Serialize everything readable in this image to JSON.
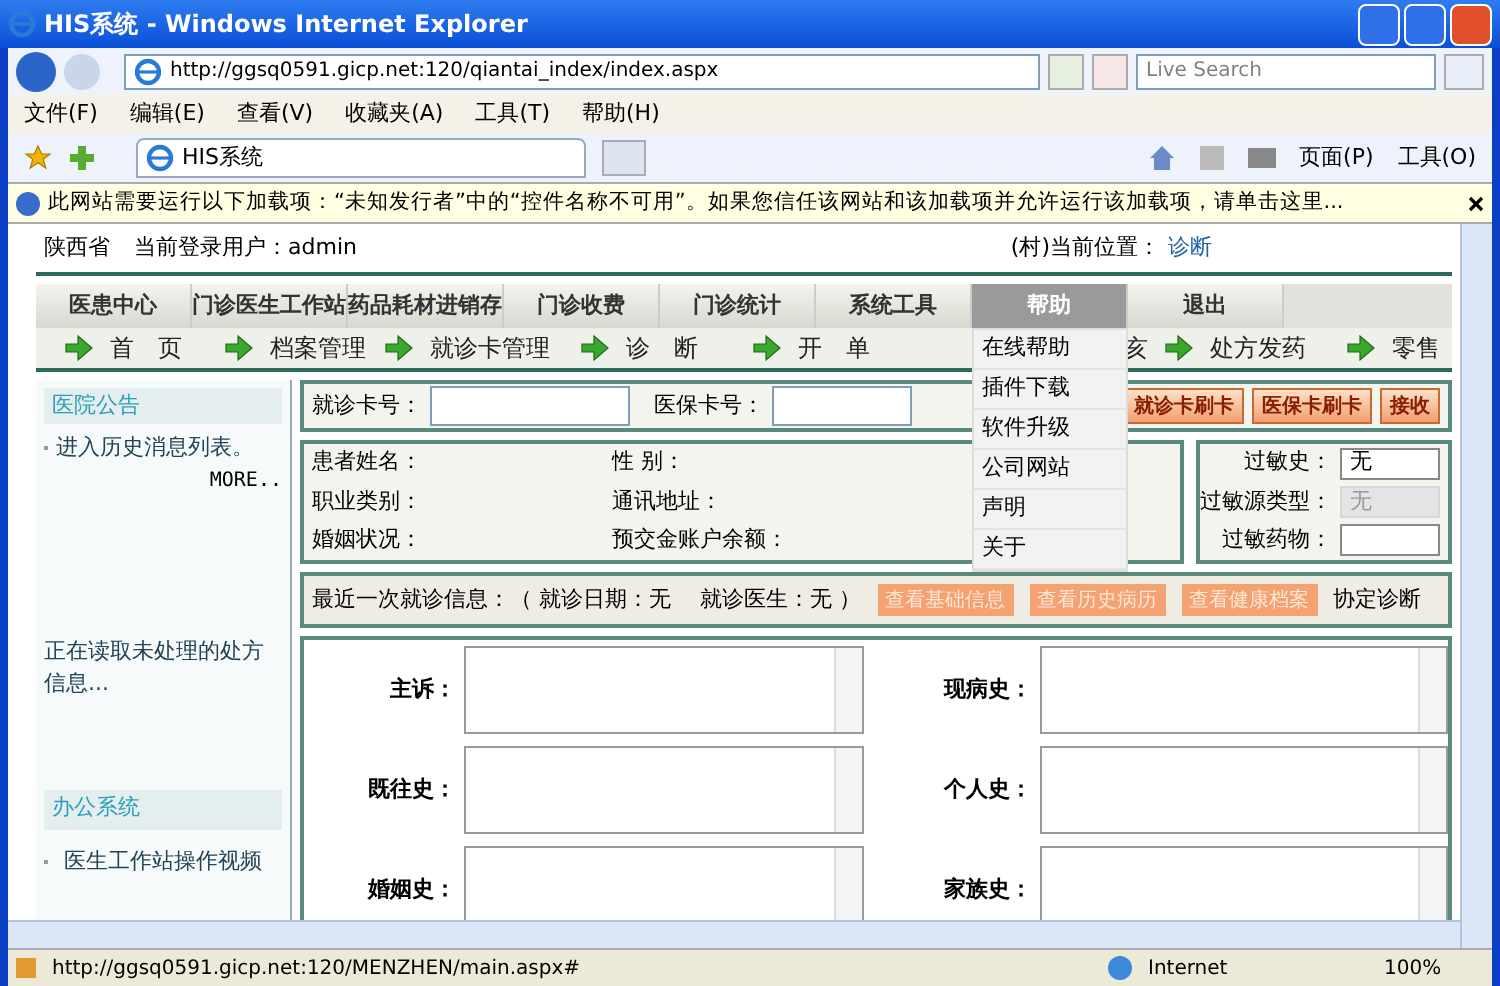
{
  "window": {
    "title": "HIS系统 - Windows Internet Explorer"
  },
  "address": {
    "url": "http://ggsq0591.gicp.net:120/qiantai_index/index.aspx",
    "search_placeholder": "Live Search"
  },
  "menu": [
    "文件(F)",
    "编辑(E)",
    "查看(V)",
    "收藏夹(A)",
    "工具(T)",
    "帮助(H)"
  ],
  "tab": {
    "title": "HIS系统"
  },
  "commands": [
    "页面(P)",
    "工具(O)"
  ],
  "infobar": {
    "text": "此网站需要运行以下加载项：“未知发行者”中的“控件名称不可用”。如果您信任该网站和该加载项并允许运行该加载项，请单击这里..."
  },
  "header": {
    "region": "陕西省",
    "user": "当前登录用户：admin",
    "location_label": "(村)当前位置：",
    "location": "诊断"
  },
  "top_menu": [
    {
      "label": "医患中心",
      "selected": false
    },
    {
      "label": "门诊医生工作站",
      "selected": false
    },
    {
      "label": "药品耗材进销存",
      "selected": false
    },
    {
      "label": "门诊收费",
      "selected": false
    },
    {
      "label": "门诊统计",
      "selected": false
    },
    {
      "label": "系统工具",
      "selected": false
    },
    {
      "label": "帮助",
      "selected": true
    },
    {
      "label": "退出",
      "selected": false
    }
  ],
  "help_menu": [
    "在线帮助",
    "插件下载",
    "软件升级",
    "公司网站",
    "声明",
    "关于"
  ],
  "nav": [
    "首　页",
    "档案管理",
    "就诊卡管理",
    "诊　断",
    "开　单",
    "亥",
    "处方发药",
    "零售"
  ],
  "sidebar": {
    "notice_title": "医院公告",
    "notice_item": "进入历史消息列表。",
    "more": "MORE..",
    "loading": "正在读取未处理的处方信息...",
    "office_title": "办公系统",
    "office_items": [
      "医生工作站操作视频"
    ]
  },
  "card_row": {
    "card_label": "就诊卡号：",
    "insurance_label": "医保卡号：",
    "buttons": [
      "就诊卡刷卡",
      "医保卡刷卡",
      "接收"
    ]
  },
  "patient": [
    {
      "label": "患者姓名：",
      "label2": "性 别："
    },
    {
      "label": "职业类别：",
      "label2": "通讯地址："
    },
    {
      "label": "婚姻状况：",
      "label2": "预交金账户余额："
    }
  ],
  "allergy": [
    {
      "label": "过敏史：",
      "value": "无",
      "disabled": false
    },
    {
      "label": "过敏源类型：",
      "value": "无",
      "disabled": true
    },
    {
      "label": "过敏药物：",
      "disabled": false
    }
  ],
  "recent": {
    "text": "最近一次就诊信息：（ 就诊日期：无　 就诊医生：无 ）",
    "buttons": [
      "查看基础信息",
      "查看历史病历",
      "查看健康档案"
    ],
    "link": "协定诊断"
  },
  "form": [
    [
      "主诉：",
      "现病史："
    ],
    [
      "既往史：",
      "个人史："
    ],
    [
      "婚姻史：",
      "家族史："
    ]
  ],
  "status_bar": {
    "url": "http://ggsq0591.gicp.net:120/MENZHEN/main.aspx#",
    "zone": "Internet",
    "zoom": "100%"
  }
}
